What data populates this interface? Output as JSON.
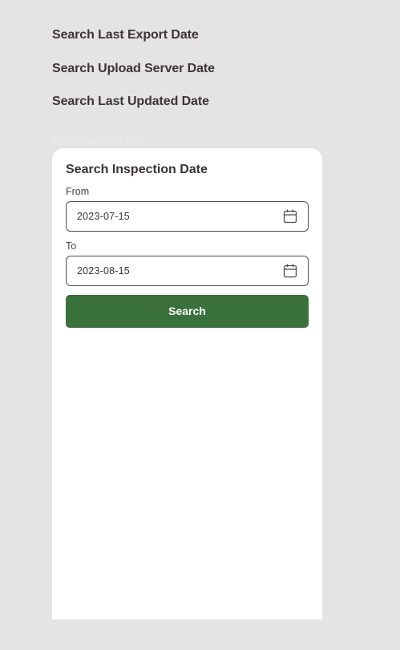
{
  "menu": {
    "items": [
      {
        "label": "Search Last Export Date"
      },
      {
        "label": "Search Upload Server Date"
      },
      {
        "label": "Search Last Updated Date"
      }
    ],
    "ghost_label": "Search Inspection Date"
  },
  "sheet": {
    "title": "Search Inspection Date",
    "from": {
      "label": "From",
      "value": "2023-07-15",
      "icon": "calendar-icon"
    },
    "to": {
      "label": "To",
      "value": "2023-08-15",
      "icon": "calendar-icon"
    },
    "search_label": "Search"
  },
  "colors": {
    "background": "#e4e4e4",
    "sheet": "#ffffff",
    "primary_button": "#3a713a",
    "text": "#3a3331"
  }
}
